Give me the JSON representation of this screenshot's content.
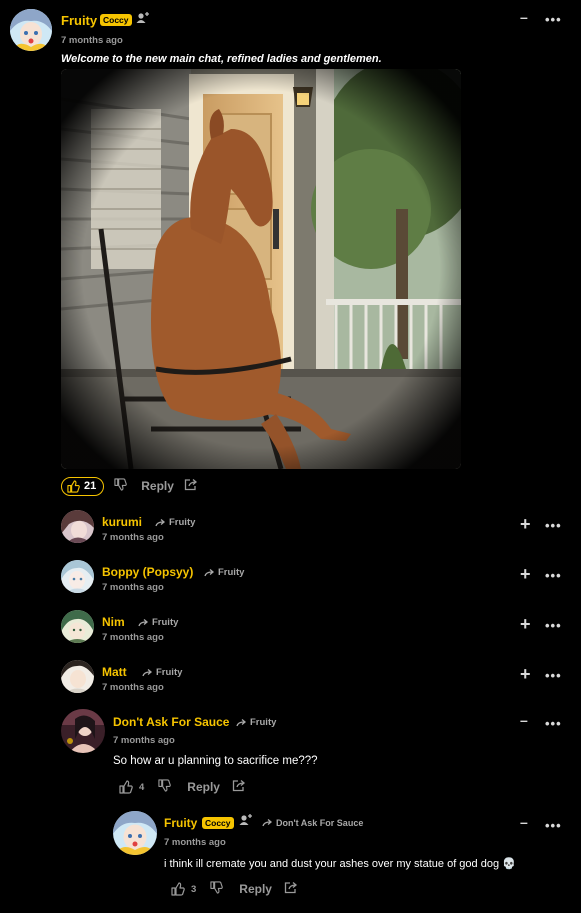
{
  "main_comment": {
    "author": "Fruity",
    "badge": "Coccy",
    "time": "7 months ago",
    "text": "Welcome to the new main chat, refined ladies and gentlemen.",
    "likes": "21",
    "reply_label": "Reply"
  },
  "replies": [
    {
      "author": "kurumi",
      "reply_to": "Fruity",
      "time": "7 months ago"
    },
    {
      "author": "Boppy (Popsyy)",
      "reply_to": "Fruity",
      "time": "7 months ago"
    },
    {
      "author": "Nim",
      "reply_to": "Fruity",
      "time": "7 months ago"
    },
    {
      "author": "Matt",
      "reply_to": "Fruity",
      "time": "7 months ago"
    }
  ],
  "expanded_reply": {
    "author": "Don't Ask For Sauce",
    "reply_to": "Fruity",
    "time": "7 months ago",
    "text": "So how ar u planning to sacrifice me???",
    "likes": "4",
    "reply_label": "Reply"
  },
  "nested_reply": {
    "author": "Fruity",
    "badge": "Coccy",
    "reply_to": "Don't Ask For Sauce",
    "time": "7 months ago",
    "text": "i think ill cremate you and dust your ashes over my statue of god dog 💀",
    "likes": "3",
    "reply_label": "Reply"
  },
  "controls": {
    "collapse": "–",
    "expand": "+",
    "more": "•••"
  },
  "colors": {
    "accent": "#f6c400",
    "background": "#000000",
    "muted": "#9a9a9a"
  },
  "icons": [
    "follow-icon",
    "thumbs-up-icon",
    "thumbs-down-icon",
    "share-icon",
    "reply-arrow-icon",
    "skull-emoji"
  ]
}
